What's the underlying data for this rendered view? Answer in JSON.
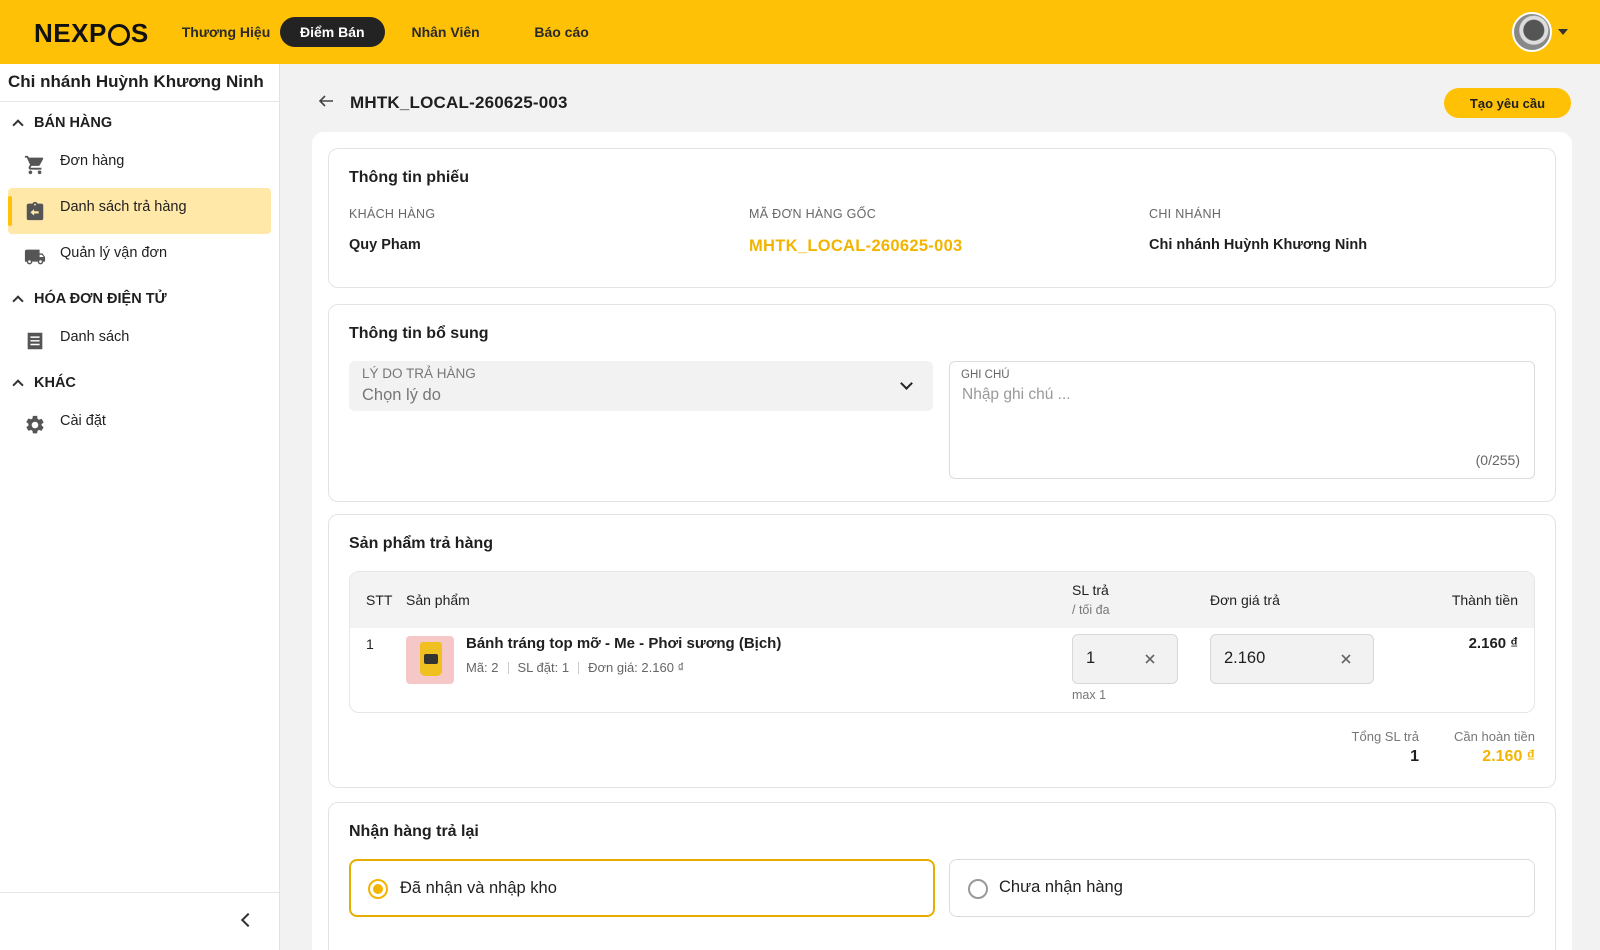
{
  "brand": {
    "logo": "NEXPOS",
    "accent": "#ffc106"
  },
  "nav": {
    "items": [
      {
        "label": "Thương Hiệu"
      },
      {
        "label": "Điểm Bán"
      },
      {
        "label": "Nhân Viên"
      },
      {
        "label": "Báo cáo"
      }
    ],
    "active": "Điểm Bán"
  },
  "sidebar": {
    "branch": "Chi nhánh Huỳnh Khương Ninh",
    "sections": [
      {
        "title": "BÁN HÀNG",
        "items": [
          {
            "label": "Đơn hàng",
            "icon": "cart-icon"
          },
          {
            "label": "Danh sách trả hàng",
            "icon": "return-box-icon",
            "active": true
          },
          {
            "label": "Quản lý vận đơn",
            "icon": "truck-icon"
          }
        ]
      },
      {
        "title": "HÓA ĐƠN ĐIỆN TỬ",
        "items": [
          {
            "label": "Danh sách",
            "icon": "list-doc-icon"
          }
        ]
      },
      {
        "title": "KHÁC",
        "items": [
          {
            "label": "Cài đặt",
            "icon": "gear-icon"
          }
        ]
      }
    ]
  },
  "header": {
    "title": "MHTK_LOCAL-260625-003",
    "create_button": "Tạo yêu cầu"
  },
  "ticket_info": {
    "title": "Thông tin phiếu",
    "customer_label": "KHÁCH HÀNG",
    "customer_value": "Quy Pham",
    "order_label": "MÃ ĐƠN HÀNG GỐC",
    "order_value": "MHTK_LOCAL-260625-003",
    "branch_label": "CHI NHÁNH",
    "branch_value": "Chi nhánh Huỳnh Khương Ninh"
  },
  "extra_info": {
    "title": "Thông tin bổ sung",
    "reason_label": "LÝ DO TRẢ HÀNG",
    "reason_placeholder": "Chọn lý do",
    "note_label": "GHI CHÚ",
    "note_placeholder": "Nhập ghi chú ...",
    "note_counter": "(0/255)"
  },
  "products": {
    "title": "Sản phẩm trả hàng",
    "columns": {
      "stt": "STT",
      "product": "Sản phẩm",
      "qty": "SL trả",
      "qty_sub": "/ tối đa",
      "price": "Đơn giá trả",
      "total": "Thành tiền"
    },
    "rows": [
      {
        "stt": "1",
        "name": "Bánh tráng top mỡ - Me - Phơi sương (Bịch)",
        "code": "Mã: 2",
        "ordered": "SL đặt: 1",
        "unit_price": "Đơn giá: 2.160 ₫",
        "qty": "1",
        "max": "max 1",
        "price": "2.160",
        "total": "2.160 ₫"
      }
    ],
    "summary": {
      "qty_label": "Tổng SL trả",
      "qty_value": "1",
      "refund_label": "Cần hoàn tiền",
      "refund_value": "2.160 ₫"
    }
  },
  "receive": {
    "title": "Nhận hàng trả lại",
    "options": [
      {
        "label": "Đã nhận và nhập kho",
        "selected": true
      },
      {
        "label": "Chưa nhận hàng",
        "selected": false
      }
    ]
  }
}
